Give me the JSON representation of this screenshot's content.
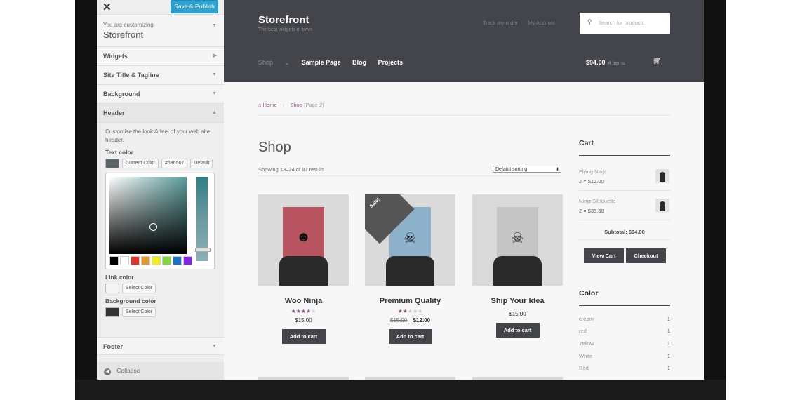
{
  "customizer": {
    "close_label": "✕",
    "save_label": "Save & Publish",
    "customizing_label": "You are customizing",
    "site_name": "Storefront",
    "sections": {
      "widgets": "Widgets",
      "title_tagline": "Site Title & Tagline",
      "background": "Background",
      "header": "Header",
      "footer": "Footer"
    },
    "header_panel": {
      "description": "Customise the look & feel of your web site header.",
      "text_color_label": "Text color",
      "current_color_btn": "Current Color",
      "hex_value": "#5a6567",
      "default_btn": "Default",
      "link_color_label": "Link color",
      "link_select_btn": "Select Color",
      "bg_color_label": "Background color",
      "bg_select_btn": "Select Color",
      "text_swatch_color": "#5a6567",
      "bg_swatch_color": "#333333",
      "palette": [
        "#000000",
        "#ffffff",
        "#dd3333",
        "#dd9933",
        "#eeee22",
        "#81d742",
        "#1e73be",
        "#8224e3"
      ]
    },
    "collapse_label": "Collapse"
  },
  "site": {
    "brand": "Storefront",
    "tagline": "The best widgets in town",
    "top_links": [
      "Track my order",
      "My Account"
    ],
    "search_placeholder": "Search for products",
    "nav": [
      "Shop",
      "Sample Page",
      "Blog",
      "Projects"
    ],
    "cart_total": "$94.00",
    "cart_items": "4 items",
    "breadcrumb": {
      "home": "Home",
      "shop": "Shop",
      "page": "(Page 2)"
    },
    "page_title": "Shop",
    "results_text": "Showing 13–24 of 87 results",
    "sort_value": "Default sorting",
    "products": [
      {
        "name": "Woo Ninja",
        "rating": 4,
        "price": "$15.00",
        "old_price": "",
        "sale": false,
        "button": "Add to cart",
        "poster_color": "#b8545f"
      },
      {
        "name": "Premium Quality",
        "rating": 2,
        "price": "$12.00",
        "old_price": "$15.00",
        "sale": true,
        "sale_label": "Sale!",
        "button": "Add to cart",
        "poster_color": "#8fb2cc"
      },
      {
        "name": "Ship Your Idea",
        "rating": 0,
        "price": "$15.00",
        "old_price": "",
        "sale": false,
        "button": "Add to cart",
        "poster_color": "#c5c5c5"
      }
    ],
    "cart_widget": {
      "title": "Cart",
      "items": [
        {
          "name": "Flying Ninja",
          "qty": "2 × $12.00"
        },
        {
          "name": "Ninja Silhouette",
          "qty": "2 × $35.00"
        }
      ],
      "subtotal": "Subtotal: $94.00",
      "view_cart": "View Cart",
      "checkout": "Checkout"
    },
    "color_widget": {
      "title": "Color",
      "items": [
        {
          "name": "cream",
          "count": "1"
        },
        {
          "name": "red",
          "count": "1"
        },
        {
          "name": "Yellow",
          "count": "1"
        },
        {
          "name": "White",
          "count": "1"
        },
        {
          "name": "Red",
          "count": "1"
        }
      ]
    }
  }
}
